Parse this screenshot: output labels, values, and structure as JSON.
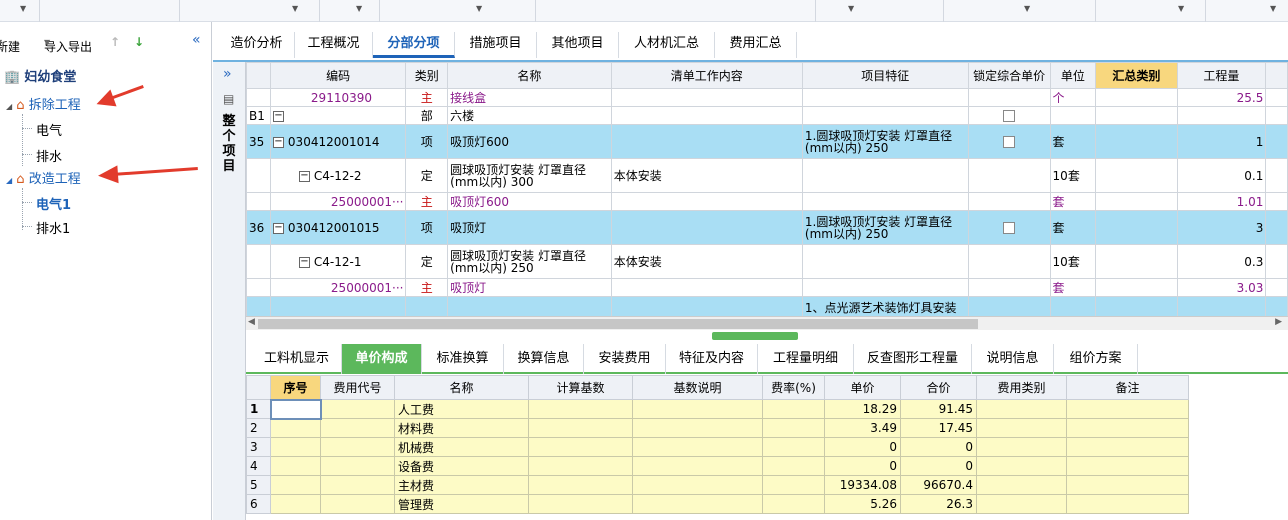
{
  "left_toolbar": {
    "new_label": "新建",
    "import_export_label": "导入导出"
  },
  "tree": {
    "root": "妇幼食堂",
    "items": [
      {
        "label": "拆除工程"
      },
      {
        "label": "电气"
      },
      {
        "label": "排水"
      },
      {
        "label": "改造工程"
      },
      {
        "label": "电气1"
      },
      {
        "label": "排水1"
      }
    ]
  },
  "tabs": [
    "造价分析",
    "工程概况",
    "分部分项",
    "措施项目",
    "其他项目",
    "人材机汇总",
    "费用汇总"
  ],
  "side_label": "整个项目",
  "grid": {
    "columns": [
      "编码",
      "类别",
      "名称",
      "清单工作内容",
      "项目特征",
      "锁定综合单价",
      "单位",
      "汇总类别",
      "工程量"
    ],
    "rows": [
      {
        "no": "",
        "code": "29110390",
        "type": "主",
        "name": "接线盒",
        "content": "",
        "feature": "",
        "unit": "个",
        "qty": "25.5"
      },
      {
        "no": "B1",
        "code": "",
        "type": "部",
        "name": "六楼",
        "content": "",
        "feature": "",
        "unit": "",
        "qty": ""
      },
      {
        "no": "35",
        "code": "030412001014",
        "type": "项",
        "name": "吸顶灯600",
        "content": "",
        "feature": "1.圆球吸顶灯安装 灯罩直径(mm以内) 250",
        "unit": "套",
        "qty": "1"
      },
      {
        "no": "",
        "code": "C4-12-2",
        "type": "定",
        "name": "圆球吸顶灯安装 灯罩直径(mm以内) 300",
        "content": "本体安装",
        "feature": "",
        "unit": "10套",
        "qty": "0.1"
      },
      {
        "no": "",
        "code": "25000001···",
        "type": "主",
        "name": "吸顶灯600",
        "content": "",
        "feature": "",
        "unit": "套",
        "qty": "1.01"
      },
      {
        "no": "36",
        "code": "030412001015",
        "type": "项",
        "name": "吸顶灯",
        "content": "",
        "feature": "1.圆球吸顶灯安装 灯罩直径(mm以内) 250",
        "unit": "套",
        "qty": "3"
      },
      {
        "no": "",
        "code": "C4-12-1",
        "type": "定",
        "name": "圆球吸顶灯安装 灯罩直径(mm以内) 250",
        "content": "本体安装",
        "feature": "",
        "unit": "10套",
        "qty": "0.3"
      },
      {
        "no": "",
        "code": "25000001···",
        "type": "主",
        "name": "吸顶灯",
        "content": "",
        "feature": "",
        "unit": "套",
        "qty": "3.03"
      },
      {
        "no": "",
        "code": "",
        "type": "",
        "name": "",
        "content": "",
        "feature": "1、点光源艺术装饰灯具安装",
        "unit": "",
        "qty": ""
      }
    ]
  },
  "bottom_tabs": [
    "工料机显示",
    "单价构成",
    "标准换算",
    "换算信息",
    "安装费用",
    "特征及内容",
    "工程量明细",
    "反查图形工程量",
    "说明信息",
    "组价方案"
  ],
  "bottom_grid": {
    "columns": [
      "序号",
      "费用代号",
      "名称",
      "计算基数",
      "基数说明",
      "费率(%)",
      "单价",
      "合价",
      "费用类别",
      "备注"
    ],
    "rows": [
      {
        "rn": "1",
        "name": "人工费",
        "price": "18.29",
        "total": "91.45"
      },
      {
        "rn": "2",
        "name": "材料费",
        "price": "3.49",
        "total": "17.45"
      },
      {
        "rn": "3",
        "name": "机械费",
        "price": "0",
        "total": "0"
      },
      {
        "rn": "4",
        "name": "设备费",
        "price": "0",
        "total": "0"
      },
      {
        "rn": "5",
        "name": "主材费",
        "price": "19334.08",
        "total": "96670.4"
      },
      {
        "rn": "6",
        "name": "管理费",
        "price": "5.26",
        "total": "26.3"
      }
    ]
  },
  "colors": {
    "accent": "#1e63b8",
    "selected_row": "#a9def4",
    "green": "#5cb85c",
    "arrow": "#e23b2c"
  }
}
